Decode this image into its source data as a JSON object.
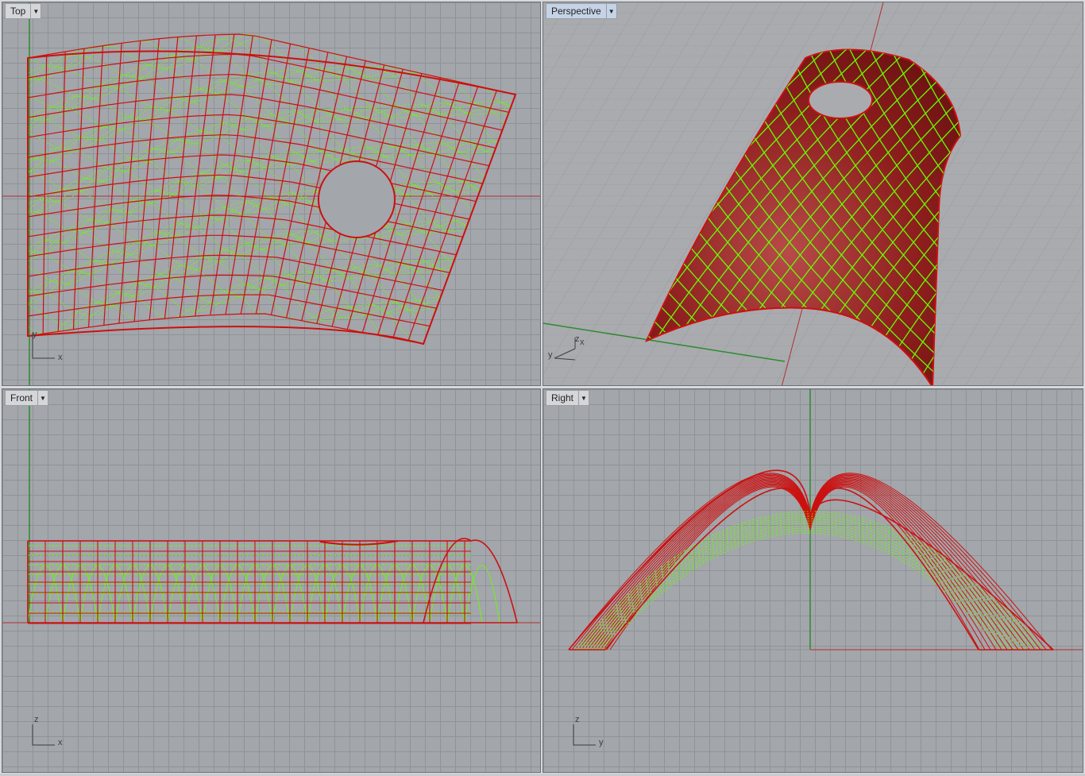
{
  "viewports": {
    "top": {
      "title": "Top",
      "axes": [
        "y",
        "x"
      ]
    },
    "perspective": {
      "title": "Perspective",
      "axes": [
        "z",
        "y",
        "x"
      ]
    },
    "front": {
      "title": "Front",
      "axes": [
        "z",
        "x"
      ]
    },
    "right": {
      "title": "Right",
      "axes": [
        "z",
        "y"
      ]
    }
  },
  "colors": {
    "viewport_bg": "#a3a6ab",
    "grid": "#8f9297",
    "curve": "#cc1010",
    "isocurve": "#66ff00",
    "axis_x": "#b03030",
    "axis_y": "#2e8b2e",
    "active_tab": "#c5d3e6"
  },
  "icons": {
    "dropdown": "chevron-down-icon"
  }
}
